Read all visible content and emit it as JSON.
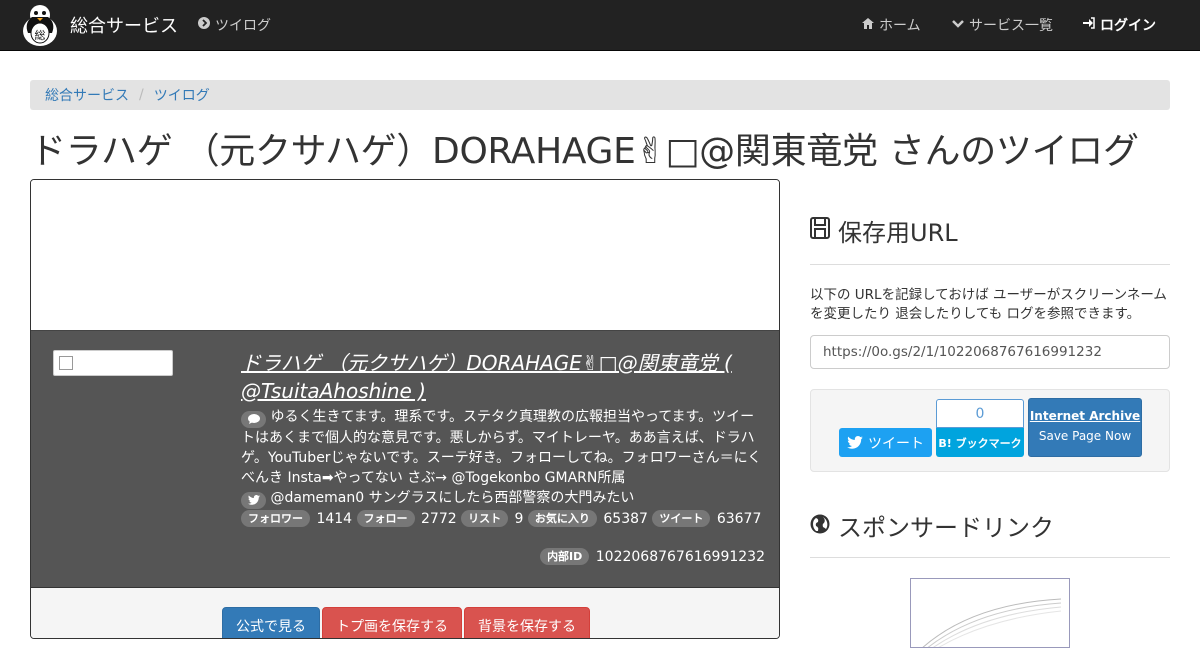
{
  "navbar": {
    "brand": "総合サービス",
    "brand_logo_text": "総",
    "tweetlog_link": "ツイログ",
    "home": "ホーム",
    "services": "サービス一覧",
    "login": "ログイン"
  },
  "breadcrumb": {
    "items": [
      "総合サービス",
      "ツイログ"
    ]
  },
  "page_title": "ドラハゲ （元クサハゲ）DORAHAGE✌︎□@関東竜党 さんのツイログ",
  "profile": {
    "name": "ドラハゲ （元クサハゲ）DORAHAGE✌︎□@関東竜党 ( @TsuitaAhoshine )",
    "bio": "ゆるく生きてます。理系です。ステタク真理教の広報担当やってます。ツイートはあくまで個人的な意見です。悪しからず。マイトレーヤ。ああ言えば、ドラハゲ。YouTuberじゃないです。スーテ好き。フォローしてね。フォロワーさん＝にくべんき Insta➡︎やってない さぶ→ @Togekonbo GMARN所属",
    "location": "@dameman0 サングラスにしたら西部警察の大門みたい",
    "stats": {
      "followers_label": "フォロワー",
      "followers": "1414",
      "following_label": "フォロー",
      "following": "2772",
      "lists_label": "リスト",
      "lists": "9",
      "favorites_label": "お気に入り",
      "favorites": "65387",
      "tweets_label": "ツイート",
      "tweets": "63677"
    },
    "internal_id_label": "内部ID",
    "internal_id": "1022068767616991232"
  },
  "buttons": {
    "official": "公式で見る",
    "save_top": "トプ画を保存する",
    "save_bg": "背景を保存する"
  },
  "sidebar": {
    "save_url_title": "保存用URL",
    "save_url_desc": "以下の URLを記録しておけば ユーザーがスクリーンネームを変更したり 退会したりしても ログを参照できます。",
    "save_url": "https://0o.gs/2/1/1022068767616991232",
    "tweet_button": "ツイート",
    "hatena_count": "0",
    "hatena_button": "B! ブックマーク",
    "ia_line1": "Internet Archive",
    "ia_line2": "Save Page Now",
    "sponsored_title": "スポンサードリンク"
  },
  "colors": {
    "navbar": "#222222",
    "profile_bg": "#555555",
    "primary": "#337ab7",
    "danger": "#d9534f",
    "twitter": "#1da1f2"
  }
}
